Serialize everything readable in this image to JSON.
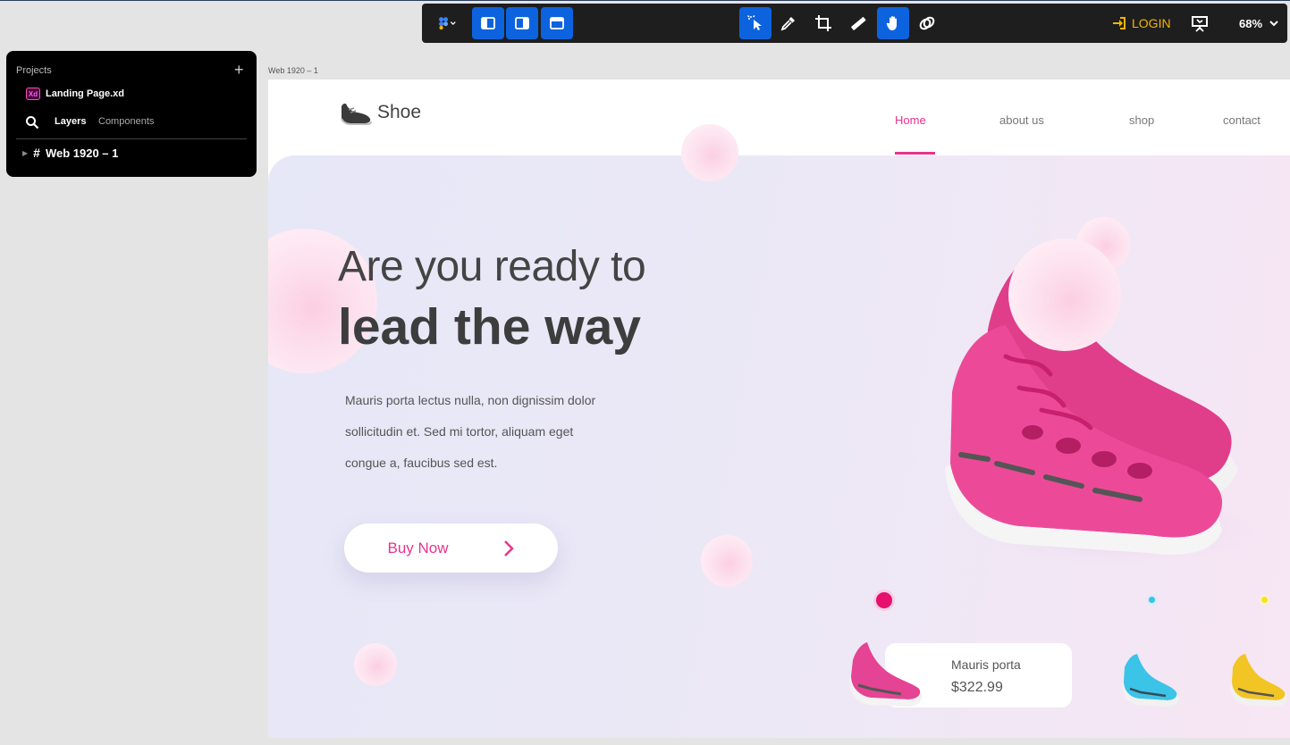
{
  "toolbar": {
    "login_label": "LOGIN",
    "zoom_level": "68%"
  },
  "panel": {
    "title": "Projects",
    "project_file": "Landing Page.xd",
    "xd_badge": "Xd",
    "tab_layers": "Layers",
    "tab_components": "Components",
    "layer_item": "Web 1920 – 1"
  },
  "artboard": {
    "label": "Web 1920 – 1"
  },
  "site": {
    "logo_text": "Shoe",
    "nav": [
      "Home",
      "about us",
      "shop",
      "contact"
    ],
    "headline_line1": "Are you ready to",
    "headline_line2": "lead the way",
    "body_lines": [
      "Mauris porta lectus nulla, non dignissim dolor",
      "sollicitudin et. Sed mi tortor, aliquam eget",
      "congue a, faucibus sed est."
    ],
    "buy_label": "Buy Now",
    "product_card": {
      "name": "Mauris porta",
      "price": "$322.99"
    }
  },
  "colors": {
    "accent_pink": "#e9338e",
    "toolbar_active": "#0d63de",
    "login_yellow": "#f5b400",
    "dot_cyan": "#39c3e6",
    "dot_yellow": "#f5e12a"
  }
}
